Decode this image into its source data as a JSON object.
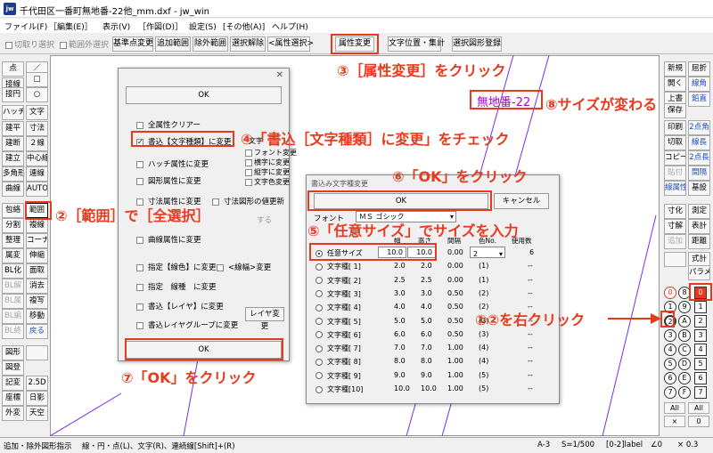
{
  "window": {
    "title": "千代田区一番町無地番-22他_mm.dxf - jw_win",
    "icon": "jw"
  },
  "menu": [
    "ファイル(F)",
    "［編集(E)］",
    "表示(V)",
    "［作図(D)］",
    "設定(S)",
    "[その他(A)]",
    "ヘルプ(H)"
  ],
  "toolbar": {
    "chk_cut": "切取り選択",
    "chk_range": "範囲外選択",
    "btn_basepoint": "基準点変更",
    "btn_add": "追加範囲",
    "btn_exclude": "除外範囲",
    "btn_deselect": "選択解除",
    "btn_attrsel": "<属性選択>",
    "btn_attrchange": "属性変更",
    "btn_textpos": "文字位置・集計",
    "btn_register": "選択図形登録"
  },
  "left_tools": [
    "点",
    "接線",
    "接円",
    "ハッチ",
    "建平",
    "建断",
    "建立",
    "多角形",
    "曲線",
    "包絡",
    "分割",
    "整理",
    "属変",
    "BL化",
    "BL解",
    "BL属",
    "BL編",
    "BL終",
    "図形",
    "図登",
    "記変",
    "座標",
    "外変"
  ],
  "left_tools2": [
    "／",
    "□",
    "○",
    "文字",
    "寸法",
    "２線",
    "中心線",
    "連線",
    "AUTO",
    "範囲",
    "複線",
    "コーナー",
    "伸縮",
    "面取",
    "消去",
    "複写",
    "移動",
    "戻る",
    "",
    "",
    "2.5D",
    "日影",
    "天空"
  ],
  "right_tools": [
    "新規",
    "開く",
    "上書",
    "保存",
    "印刷",
    "切取",
    "コピー",
    "貼付",
    "線属性",
    "測定",
    "寸化",
    "寸解",
    "追加"
  ],
  "right_tools2": [
    "屈折",
    "線角",
    "鉛直",
    "2点角",
    "線長",
    "2点長",
    "間隔",
    "基設",
    "表計",
    "距離",
    "式計",
    "パラメ"
  ],
  "layers": [
    "0",
    "1",
    "2",
    "3",
    "4",
    "5",
    "6",
    "7",
    "8",
    "9",
    "A",
    "B",
    "C",
    "D",
    "E",
    "F"
  ],
  "layer_bottom": {
    "all": "All",
    "x": "×",
    "zero": "0"
  },
  "attr_dialog": {
    "ok_top": "OK",
    "ok_bottom": "OK",
    "items": [
      "全属性クリアー",
      "書込【文字種類】に変更",
      "ハッチ属性に変更",
      "図形属性に変更",
      "寸法属性に変更",
      "寸法図形の値更新",
      "曲線属性に変更",
      "指定【線色】に変更",
      "<線幅>変更",
      "指定　線種　に変更",
      "書込【レイヤ】に変更",
      "書込レイヤグループに変更"
    ],
    "side_items": [
      "文字",
      "フォント変更",
      "横字に変更",
      "縦字に変更",
      "文字色変更"
    ],
    "layer_btn": "レイヤ変更",
    "partial": "する"
  },
  "text_dialog": {
    "title": "書込み文字種変更",
    "ok": "OK",
    "cancel": "キャンセル",
    "font_label": "フォント",
    "font_value": "ＭＳ ゴシック",
    "headers": [
      "幅",
      "高さ",
      "間隔",
      "色No.",
      "使用数"
    ],
    "rows": [
      {
        "name": "任意サイズ",
        "w": "10.0",
        "h": "10.0",
        "s": "0.00",
        "c": "2",
        "n": "6",
        "selected": true
      },
      {
        "name": "文字種[ 1]",
        "w": "2.0",
        "h": "2.0",
        "s": "0.00",
        "c": "(1)",
        "n": "--"
      },
      {
        "name": "文字種[ 2]",
        "w": "2.5",
        "h": "2.5",
        "s": "0.00",
        "c": "(1)",
        "n": "--"
      },
      {
        "name": "文字種[ 3]",
        "w": "3.0",
        "h": "3.0",
        "s": "0.50",
        "c": "(2)",
        "n": "--"
      },
      {
        "name": "文字種[ 4]",
        "w": "4.0",
        "h": "4.0",
        "s": "0.50",
        "c": "(2)",
        "n": "--"
      },
      {
        "name": "文字種[ 5]",
        "w": "5.0",
        "h": "5.0",
        "s": "0.50",
        "c": "(3)",
        "n": "--"
      },
      {
        "name": "文字種[ 6]",
        "w": "6.0",
        "h": "6.0",
        "s": "0.50",
        "c": "(3)",
        "n": "--"
      },
      {
        "name": "文字種[ 7]",
        "w": "7.0",
        "h": "7.0",
        "s": "1.00",
        "c": "(4)",
        "n": "--"
      },
      {
        "name": "文字種[ 8]",
        "w": "8.0",
        "h": "8.0",
        "s": "1.00",
        "c": "(4)",
        "n": "--"
      },
      {
        "name": "文字種[ 9]",
        "w": "9.0",
        "h": "9.0",
        "s": "1.00",
        "c": "(5)",
        "n": "--"
      },
      {
        "name": "文字種[10]",
        "w": "10.0",
        "h": "10.0",
        "s": "1.00",
        "c": "(5)",
        "n": "--"
      }
    ]
  },
  "canvas_text": "無地番-22",
  "annotations": {
    "a1": "①②を右クリック",
    "a2": "②［範囲］で［全選択］",
    "a3": "③［属性変更］をクリック",
    "a4": "④「書込［文字種類］に変更」をチェック",
    "a5": "⑤「任意サイズ」でサイズを入力",
    "a6": "⑥「OK」をクリック",
    "a7": "⑦「OK」をクリック",
    "a8": "⑧サイズが変わる"
  },
  "status": {
    "msg": "追加・除外図形指示",
    "hint": "線・円・点(L)、文字(R)、連続線[Shift]+(R)",
    "paper": "A-3",
    "scale": "S=1/500",
    "layer": "[0-2]label",
    "angle": "∠0",
    "zoom": "× 0.3"
  },
  "colors": {
    "accent": "#e8391d",
    "canvas_text": "#b000d0",
    "diag_lines": "#7a2ee8"
  }
}
